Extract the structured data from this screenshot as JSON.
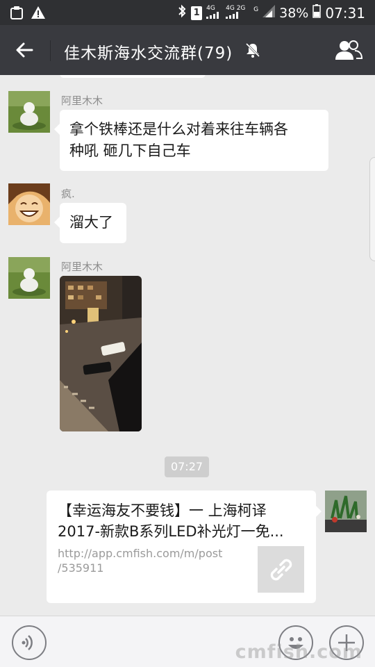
{
  "status_bar": {
    "battery": "38%",
    "time": "07:31",
    "sim_badge": "1",
    "network_a": "4G",
    "network_b": "4G 2G",
    "g_label": "G"
  },
  "header": {
    "title": "佳木斯海水交流群(79)",
    "back_icon": "arrow-left-icon",
    "mute_icon": "bell-off-icon",
    "members_icon": "group-icon"
  },
  "messages": [
    {
      "sender": "阿里木木",
      "text_lines": [
        "拿个铁棒还是什么对着来往车辆各",
        "种吼 砸几下自己车"
      ]
    },
    {
      "sender": "疯.",
      "text": "溜大了"
    },
    {
      "sender": "阿里木木",
      "type": "image"
    }
  ],
  "timestamp": "07:27",
  "link_card": {
    "title_lines": [
      "【幸运海友不要钱】一 上海柯译",
      "2017-新款B系列LED补光灯一免..."
    ],
    "url_lines": [
      "http://app.cmfish.com/m/post",
      "/535911"
    ],
    "thumb_icon": "link-icon"
  },
  "input_bar": {
    "voice_icon": "voice-icon",
    "emoji_icon": "smiley-icon",
    "plus_icon": "plus-icon",
    "watermark": "cmfish.com"
  },
  "colors": {
    "status_bg": "#2f3033",
    "header_bg": "#393a3f",
    "chat_bg": "#ebebeb",
    "bubble_bg": "#ffffff",
    "time_chip_bg": "#cecece"
  }
}
